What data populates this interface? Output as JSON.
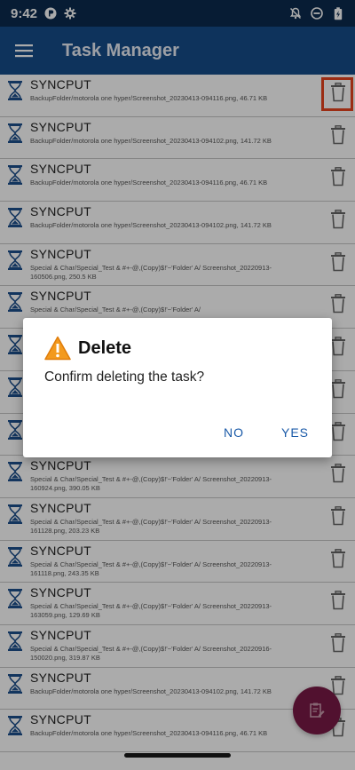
{
  "status_bar": {
    "time": "9:42"
  },
  "app_bar": {
    "title": "Task Manager",
    "menu_icon": "hamburger-menu-icon"
  },
  "tasks": [
    {
      "title": "SYNCPUT",
      "detail": "BackupFolder/motorola one hyper/Screenshot_20230413-094116.png, 46.71 KB"
    },
    {
      "title": "SYNCPUT",
      "detail": "BackupFolder/motorola one hyper/Screenshot_20230413-094102.png, 141.72 KB"
    },
    {
      "title": "SYNCPUT",
      "detail": "BackupFolder/motorola one hyper/Screenshot_20230413-094116.png, 46.71 KB"
    },
    {
      "title": "SYNCPUT",
      "detail": "BackupFolder/motorola one hyper/Screenshot_20230413-094102.png, 141.72 KB"
    },
    {
      "title": "SYNCPUT",
      "detail": "Special & Char/Special_Test & #+-@,(Copy)$!'~'Folder' A/ Screenshot_20220913-160506.png, 250.5 KB"
    },
    {
      "title": "SYNCPUT",
      "detail": "Special & Char/Special_Test & #+-@,(Copy)$!'~'Folder' A/"
    },
    {
      "title": "",
      "detail": ""
    },
    {
      "title": "",
      "detail": ""
    },
    {
      "title": "",
      "detail": ""
    },
    {
      "title": "SYNCPUT",
      "detail": "Special & Char/Special_Test & #+-@,(Copy)$!'~'Folder' A/ Screenshot_20220913-160924.png, 390.05 KB"
    },
    {
      "title": "SYNCPUT",
      "detail": "Special & Char/Special_Test & #+-@,(Copy)$!'~'Folder' A/ Screenshot_20220913-161128.png, 203.23 KB"
    },
    {
      "title": "SYNCPUT",
      "detail": "Special & Char/Special_Test & #+-@,(Copy)$!'~'Folder' A/ Screenshot_20220913-161118.png, 243.35 KB"
    },
    {
      "title": "SYNCPUT",
      "detail": "Special & Char/Special_Test & #+-@,(Copy)$!'~'Folder' A/ Screenshot_20220913-163059.png, 129.69 KB"
    },
    {
      "title": "SYNCPUT",
      "detail": "Special & Char/Special_Test & #+-@,(Copy)$!'~'Folder' A/ Screenshot_20220916-150020.png, 319.87 KB"
    },
    {
      "title": "SYNCPUT",
      "detail": "BackupFolder/motorola one hyper/Screenshot_20230413-094102.png, 141.72 KB"
    },
    {
      "title": "SYNCPUT",
      "detail": "BackupFolder/motorola one hyper/Screenshot_20230413-094116.png, 46.71 KB"
    }
  ],
  "dialog": {
    "title": "Delete",
    "message": "Confirm deleting the task?",
    "no_label": "NO",
    "yes_label": "YES"
  },
  "colors": {
    "app_bar": "#154c8a",
    "status_bar": "#0b2a4e",
    "fab": "#7a1a46",
    "accent": "#1a5aa8",
    "highlight": "#e8441e"
  }
}
